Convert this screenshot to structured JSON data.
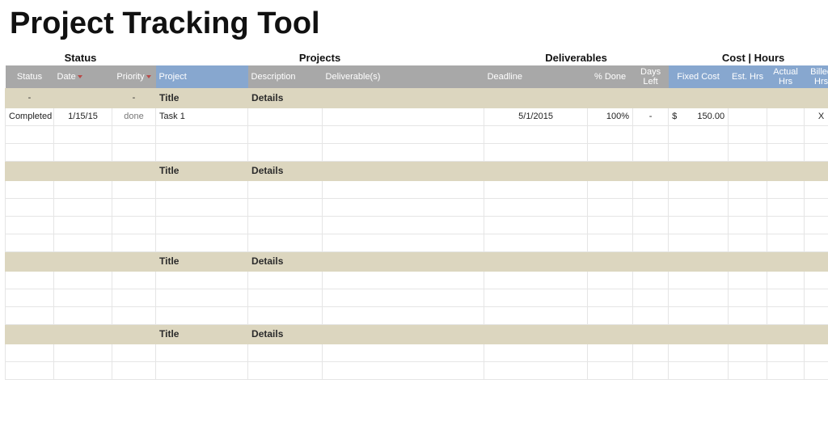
{
  "title": "Project Tracking Tool",
  "super_headers": {
    "status": "Status",
    "projects": "Projects",
    "deliverables": "Deliverables",
    "cost_hours": "Cost | Hours"
  },
  "columns": {
    "status": "Status",
    "date": "Date",
    "priority": "Priority",
    "project": "Project",
    "description": "Description",
    "deliverable": "Deliverable(s)",
    "deadline": "Deadline",
    "pct_done": "% Done",
    "days_left": "Days Left",
    "fixed_cost": "Fixed Cost",
    "est_hrs": "Est. Hrs",
    "actual_hrs": "Actual Hrs",
    "billed_hrs": "Billed Hrs"
  },
  "section": {
    "placeholder_status": "-",
    "placeholder_priority": "-",
    "title_label": "Title",
    "details_label": "Details"
  },
  "row1": {
    "status": "Completed",
    "date": "1/15/15",
    "priority": "done",
    "project": "Task 1",
    "description": "",
    "deliverable": "",
    "deadline": "5/1/2015",
    "pct_done": "100%",
    "days_left": "-",
    "fixed_cost_currency": "$",
    "fixed_cost_value": "150.00",
    "est_hrs": "",
    "actual_hrs": "",
    "billed_hrs": "X"
  }
}
